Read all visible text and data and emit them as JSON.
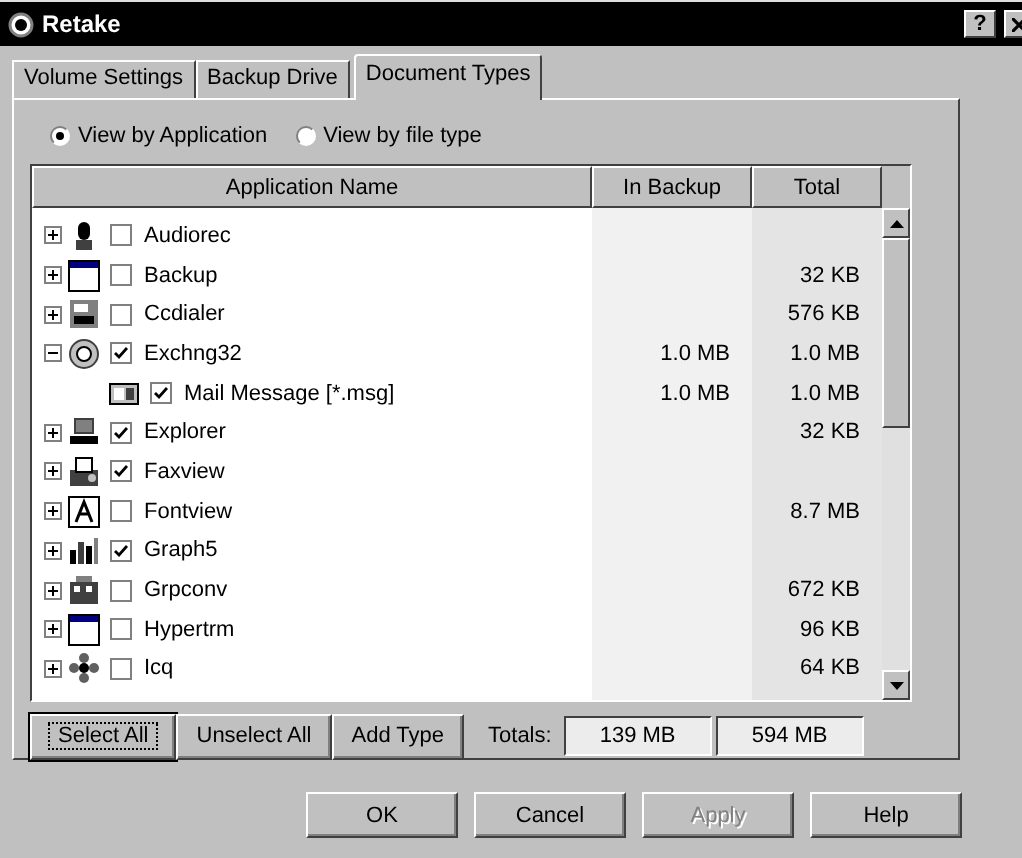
{
  "window": {
    "title": "Retake",
    "help_button": "?"
  },
  "tabs": [
    {
      "label": "Volume Settings",
      "selected": false
    },
    {
      "label": "Backup Drive",
      "selected": false
    },
    {
      "label": "Document Types",
      "selected": true
    }
  ],
  "view_options": [
    {
      "label": "View by Application",
      "selected": true
    },
    {
      "label": "View by file type",
      "selected": false
    }
  ],
  "table": {
    "columns": [
      "Application Name",
      "In Backup",
      "Total"
    ],
    "rows": [
      {
        "name": "Audiorec",
        "checked": false,
        "expanded": false
      },
      {
        "name": "Backup",
        "checked": false,
        "expanded": false,
        "total": "32 KB"
      },
      {
        "name": "Ccdialer",
        "checked": false,
        "expanded": false,
        "total": "576 KB"
      },
      {
        "name": "Exchng32",
        "checked": true,
        "expanded": true,
        "in_backup": "1.0 MB",
        "total": "1.0 MB",
        "children": [
          {
            "name": "Mail Message [*.msg]",
            "checked": true,
            "in_backup": "1.0 MB",
            "total": "1.0 MB"
          }
        ]
      },
      {
        "name": "Explorer",
        "checked": true,
        "expanded": false,
        "total": "32 KB"
      },
      {
        "name": "Faxview",
        "checked": true,
        "expanded": false
      },
      {
        "name": "Fontview",
        "checked": false,
        "expanded": false,
        "total": "8.7 MB"
      },
      {
        "name": "Graph5",
        "checked": true,
        "expanded": false
      },
      {
        "name": "Grpconv",
        "checked": false,
        "expanded": false,
        "total": "672 KB"
      },
      {
        "name": "Hypertrm",
        "checked": false,
        "expanded": false,
        "total": "96 KB"
      },
      {
        "name": "Icq",
        "checked": false,
        "expanded": false,
        "total": "64 KB"
      }
    ]
  },
  "list_buttons": [
    {
      "label": "Select All",
      "focused": true
    },
    {
      "label": "Unselect All",
      "focused": false
    },
    {
      "label": "Add Type",
      "focused": false
    }
  ],
  "totals": {
    "label": "Totals:",
    "in_backup": "139 MB",
    "total": "594 MB"
  },
  "dialog_buttons": [
    {
      "label": "OK",
      "disabled": false
    },
    {
      "label": "Cancel",
      "disabled": false
    },
    {
      "label": "Apply",
      "disabled": true
    },
    {
      "label": "Help",
      "disabled": false
    }
  ]
}
